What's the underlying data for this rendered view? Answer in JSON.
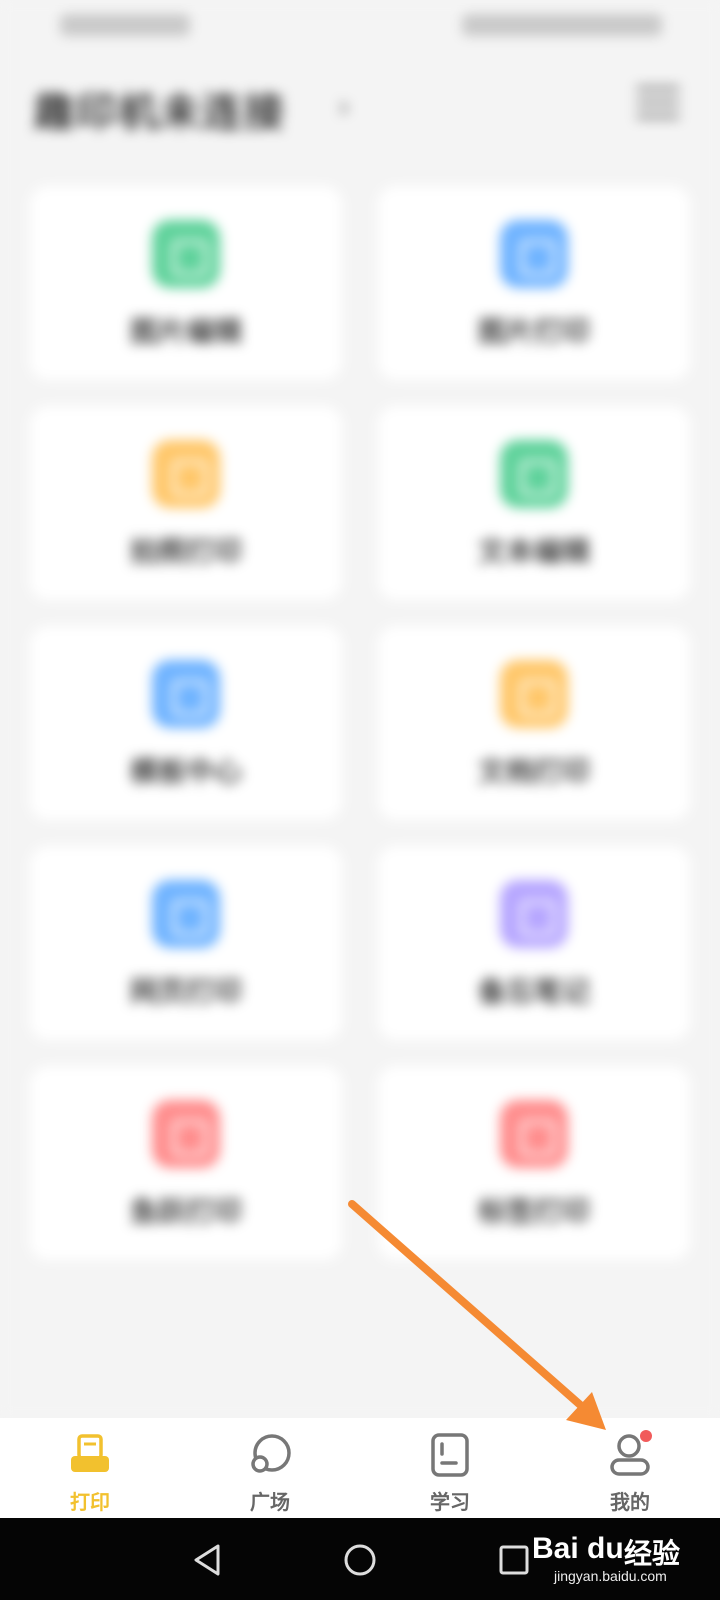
{
  "app": {
    "title": "趣印机未连接",
    "title_chevron": "›"
  },
  "cards": [
    {
      "label": "图片编辑",
      "color": "#5fd29b",
      "icon": "image-edit-icon"
    },
    {
      "label": "图片打印",
      "color": "#6fb3ff",
      "icon": "image-print-icon"
    },
    {
      "label": "拍照打印",
      "color": "#ffc76a",
      "icon": "camera-print-icon"
    },
    {
      "label": "文本编辑",
      "color": "#5fd29b",
      "icon": "text-edit-icon"
    },
    {
      "label": "模板中心",
      "color": "#6fb3ff",
      "icon": "template-center-icon"
    },
    {
      "label": "文档打印",
      "color": "#ffc76a",
      "icon": "document-print-icon"
    },
    {
      "label": "网页打印",
      "color": "#6fb3ff",
      "icon": "webpage-print-icon"
    },
    {
      "label": "备忘笔记",
      "color": "#b6a6ff",
      "icon": "memo-note-icon"
    },
    {
      "label": "鱼跃打印",
      "color": "#ff8d8d",
      "icon": "clock-print-icon"
    },
    {
      "label": "标签打印",
      "color": "#ff8d8d",
      "icon": "label-print-icon"
    }
  ],
  "tabbar": {
    "tabs": [
      {
        "label": "打印",
        "icon": "printer-icon",
        "active": true
      },
      {
        "label": "广场",
        "icon": "planet-icon",
        "active": false
      },
      {
        "label": "学习",
        "icon": "book-icon",
        "active": false
      },
      {
        "label": "我的",
        "icon": "profile-icon",
        "active": false
      }
    ],
    "active_color": "#f2c12e",
    "notify_color": "#f15b5b"
  },
  "watermark": {
    "brand": "Bai du",
    "brand_cn": "经验",
    "url": "jingyan.baidu.com"
  },
  "annotation": {
    "arrow_color": "#f58a33"
  }
}
